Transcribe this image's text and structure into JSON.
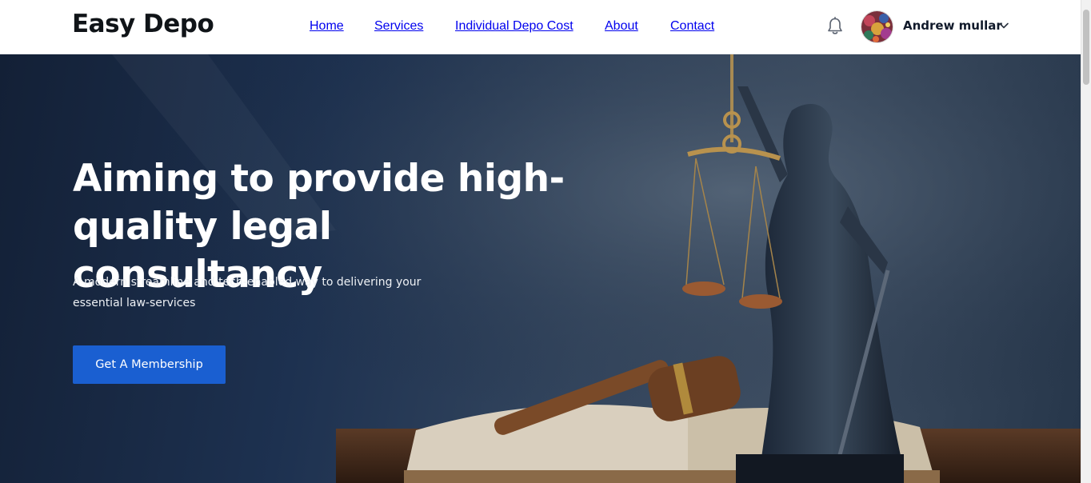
{
  "header": {
    "logo": "Easy Depo",
    "nav": [
      {
        "label": "Home"
      },
      {
        "label": "Services"
      },
      {
        "label": "Individual Depo Cost"
      },
      {
        "label": "About"
      },
      {
        "label": "Contact"
      }
    ],
    "notification_icon": "bell-icon",
    "user": {
      "name": "Andrew mullar",
      "menu_icon": "chevron-down-icon"
    }
  },
  "hero": {
    "title": "Aiming to provide high-quality legal consultancy",
    "subtitle": "A modern,streamline and tech-enabled way to delivering your essential law-services",
    "cta_label": "Get A Membership",
    "image": "lady-justice-statue-with-gavel-and-book"
  },
  "colors": {
    "accent": "#1a5fd1",
    "hero_dark": "#1d3150",
    "text_dark": "#101418",
    "header_bg": "#ffffff"
  }
}
